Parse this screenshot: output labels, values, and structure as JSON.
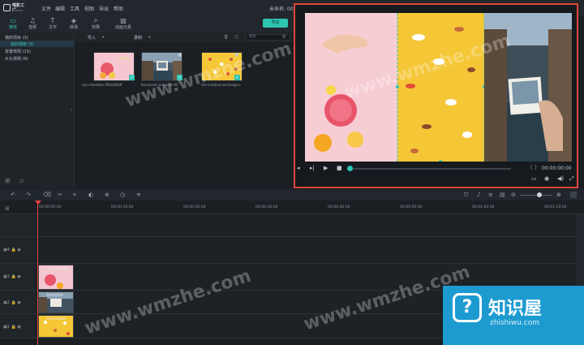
{
  "app": {
    "logo_text": "喵影工厂",
    "logo_sub": "Filmora",
    "menu": [
      "文件",
      "编辑",
      "工具",
      "视图",
      "导出",
      "帮助"
    ],
    "project_title": "未命名: 00:00:05:00"
  },
  "toolbar": {
    "tabs": [
      {
        "icon": "media-icon",
        "label": "媒体"
      },
      {
        "icon": "music-icon",
        "label": "音频"
      },
      {
        "icon": "text-icon",
        "label": "文字"
      },
      {
        "icon": "transition-icon",
        "label": "转场"
      },
      {
        "icon": "effects-icon",
        "label": "效果"
      },
      {
        "icon": "elements-icon",
        "label": "动画元素"
      }
    ],
    "export_label": "导出"
  },
  "left_panel": {
    "items": [
      "我的项目 (3)",
      "我的相册 (3)",
      "背景样例 (15)",
      "片头样例 (9)"
    ]
  },
  "media": {
    "import_label": "导入",
    "record_label": "录制",
    "search_placeholder": "搜索",
    "items": [
      {
        "name": "say-chambler-360c8d2df"
      },
      {
        "name": "blurytrees-antonios-9C"
      },
      {
        "name": "the-creative-exchange-s"
      }
    ]
  },
  "preview": {
    "timecode": "00:00:00:00",
    "bracket": "{ }"
  },
  "timeline": {
    "ruler": [
      "00:00:00:00",
      "00:00:10:00",
      "00:00:20:00",
      "00:00:30:00",
      "00:00:40:00",
      "00:00:50:00",
      "00:01:00:00",
      "00:01:10:00"
    ],
    "tracks": [
      {
        "label": "4",
        "clip": ""
      },
      {
        "label": "3",
        "clip": "say-chamb"
      },
      {
        "label": "2",
        "clip": "blurytre"
      },
      {
        "label": "1",
        "clip": "the-creat"
      }
    ]
  },
  "watermark": {
    "text": "www.wmzhe.com",
    "brand_name": "知识屋",
    "brand_url": "zhishiwu.com"
  }
}
